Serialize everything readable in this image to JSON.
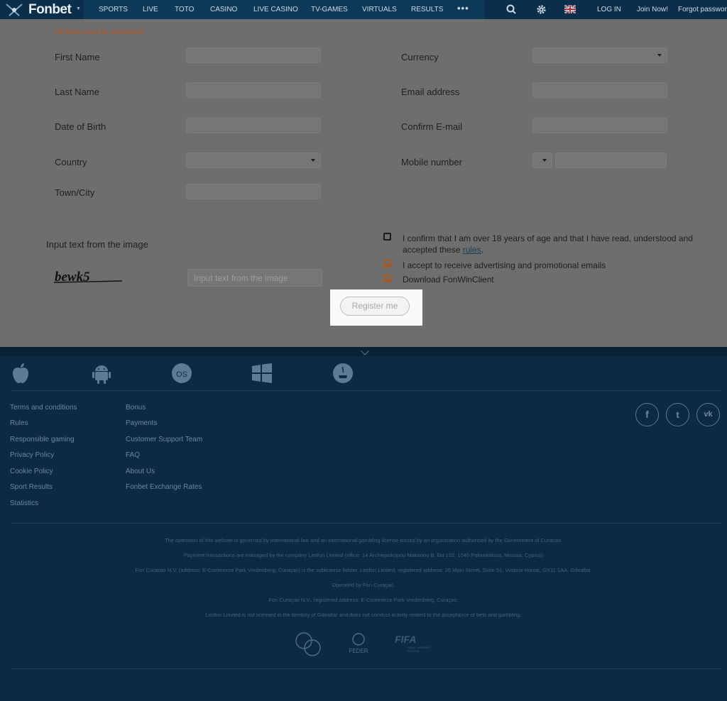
{
  "header": {
    "brand": "Fonbet",
    "nav": [
      "SPORTS",
      "LIVE",
      "TOTO",
      "CASINO",
      "LIVE CASINO",
      "TV-GAMES",
      "VIRTUALS",
      "RESULTS"
    ],
    "more": "•••",
    "login": "LOG IN",
    "join": "Join Now!",
    "forgot": "Forgot password"
  },
  "form": {
    "notice": "All fields must be completed",
    "left_labels": [
      "First Name",
      "Last Name",
      "Date of Birth",
      "Country",
      "Town/City"
    ],
    "right_labels": [
      "Currency",
      "Email address",
      "Confirm E-mail",
      "Mobile number"
    ],
    "captcha_label": "Input text from the image",
    "captcha_text": "bewk5",
    "captcha_placeholder": "Input text from the image",
    "confirm_line1": "I confirm that I am over 18 years of age and that I have read, understood and",
    "confirm_line2_pre": "accepted these ",
    "confirm_rules": "rules",
    "confirm_line2_post": ".",
    "advert": "I accept to receive advertising and promotional emails",
    "download": "Download FonWinClient",
    "register": "Register me"
  },
  "footer": {
    "platforms": [
      "apple-icon",
      "android-icon",
      "ios-icon",
      "windows-icon",
      "java-icon"
    ],
    "col1": [
      "Terms and conditions",
      "Rules",
      "Responsible gaming",
      "Privacy Policy",
      "Cookie Policy",
      "Sport Results",
      "Statistics"
    ],
    "col2": [
      "Bonus",
      "Payments",
      "Customer Support Team",
      "FAQ",
      "About Us",
      "Fonbet Exchange Rates"
    ],
    "social": [
      "f",
      "t",
      "vk"
    ],
    "legal": [
      "The operation of this website is governed by international law and an international gambling license issued by an organisation authorised by the Government of Curacao.",
      "Payment transactions are managed by the company Leofon Limited (office: 14 Archiepiskopou Makariou B, flat 102, 1040 Palouriotissa, Nicosia, Cyprus)",
      "Fon Curacao N.V. (address: E-Commerce Park Vredenberg, Curaçao) is the sublicense holder.   Leofon Limited, registered address: 26 Main Street, Suite 51, Victoria House, GX11 1AA, Gibraltar.",
      "Operated by Fon Curaçao.",
      "Fon Curaçao N.V., registered address: E-Commerce Park Vredenberg, Curaçao.",
      "Leofon Limited is not licensed in the territory of Gibraltar and  does not conduct activity related to the acceptance of bets and gambling."
    ],
    "partners": {
      "feder": "FEDER",
      "fifa": "FIFA",
      "fifa_sub1": "EARLY WARNING",
      "fifa_sub2": "SYSTEM"
    }
  },
  "colors": {
    "header_bg": "#0e3a5a",
    "footer_bg": "#0c2a42",
    "notice": "#b4541d",
    "accent": "#a55a23"
  }
}
